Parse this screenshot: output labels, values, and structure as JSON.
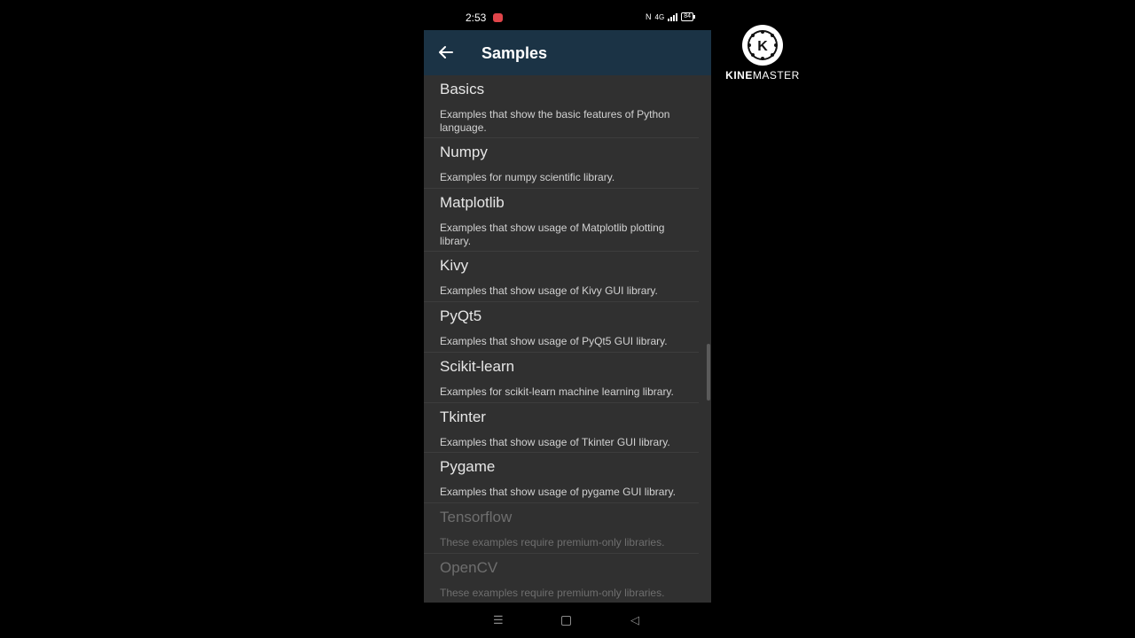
{
  "status_bar": {
    "time": "2:53",
    "network": "4G",
    "battery": "84"
  },
  "app_bar": {
    "title": "Samples",
    "back_icon": "arrow-left-icon"
  },
  "samples": [
    {
      "title": "Basics",
      "description": "Examples that show the basic features of Python language.",
      "enabled": true
    },
    {
      "title": "Numpy",
      "description": "Examples for numpy scientific library.",
      "enabled": true
    },
    {
      "title": "Matplotlib",
      "description": "Examples that show usage of Matplotlib plotting library.",
      "enabled": true
    },
    {
      "title": "Kivy",
      "description": "Examples that show usage of Kivy GUI library.",
      "enabled": true
    },
    {
      "title": "PyQt5",
      "description": "Examples that show usage of PyQt5 GUI library.",
      "enabled": true
    },
    {
      "title": "Scikit-learn",
      "description": "Examples for scikit-learn machine learning library.",
      "enabled": true
    },
    {
      "title": "Tkinter",
      "description": "Examples that show usage of Tkinter GUI library.",
      "enabled": true
    },
    {
      "title": "Pygame",
      "description": "Examples that show usage of pygame GUI library.",
      "enabled": true
    },
    {
      "title": "Tensorflow",
      "description": "These examples require premium-only libraries.",
      "enabled": false
    },
    {
      "title": "OpenCV",
      "description": "These examples require premium-only libraries.",
      "enabled": false
    }
  ],
  "nav_bar": {
    "menu_icon": "recent-apps-icon",
    "home_icon": "home-icon",
    "back_icon": "back-triangle-icon"
  },
  "watermark": {
    "logo_letter": "K",
    "brand_bold": "KINE",
    "brand_rest": "MASTER"
  },
  "colors": {
    "app_bar": "#1b3345",
    "background": "#303030",
    "disabled_text": "#6e6e6e"
  }
}
